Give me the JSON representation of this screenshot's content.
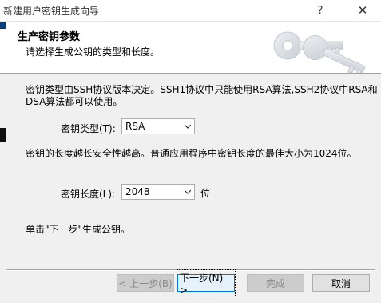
{
  "window": {
    "title": "新建用户密钥生成向导",
    "help_glyph": "?",
    "close_glyph": "✕"
  },
  "header": {
    "title": "生产密钥参数",
    "subtitle": "请选择生成公钥的类型和长度。"
  },
  "body": {
    "desc1_line1": "密钥类型由SSH协议版本决定。SSH1协议中只能使用RSA算法,SSH2协议中RSA和",
    "desc1_line2": "DSA算法都可以使用。",
    "key_type_label": "密钥类型(T):",
    "key_type_value": "RSA",
    "desc2": "密钥的长度越长安全性越高。普通应用程序中密钥长度的最佳大小为1024位。",
    "key_length_label": "密钥长度(L):",
    "key_length_value": "2048",
    "key_length_unit": "位",
    "footer_hint": "单击\"下一步\"生成公钥。"
  },
  "buttons": {
    "back": "< 上一步(B)",
    "next": "下一步(N) >",
    "finish": "完成",
    "cancel": "取消"
  },
  "colors": {
    "accent": "#0078d7",
    "dialog_bg": "#f0f0f0",
    "header_bg": "#ffffff"
  }
}
